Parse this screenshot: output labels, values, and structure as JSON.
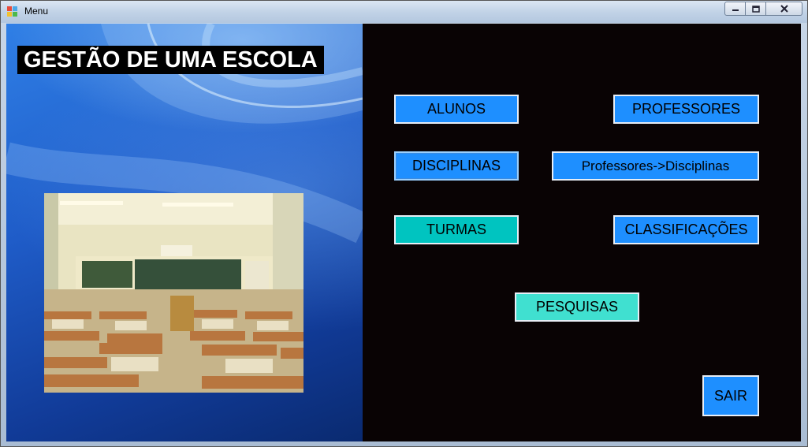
{
  "window": {
    "title": "Menu",
    "app_icon": "windows-form-icon",
    "controls": [
      "minimize-icon",
      "maximize-icon",
      "close-icon"
    ]
  },
  "header": {
    "title": "GESTÃO DE UMA ESCOLA"
  },
  "menu": {
    "alunos": "ALUNOS",
    "professores": "PROFESSORES",
    "disciplinas": "DISCIPLINAS",
    "professores_disciplinas": "Professores->Disciplinas",
    "turmas": "TURMAS",
    "classificacoes": "CLASSIFICAÇÕES",
    "pesquisas": "PESQUISAS",
    "sair": "SAIR"
  },
  "colors": {
    "button_blue": "#1e8fff",
    "button_cyan": "#00c4c0",
    "button_aqua": "#40e0d0",
    "panel_dark": "#090304"
  }
}
